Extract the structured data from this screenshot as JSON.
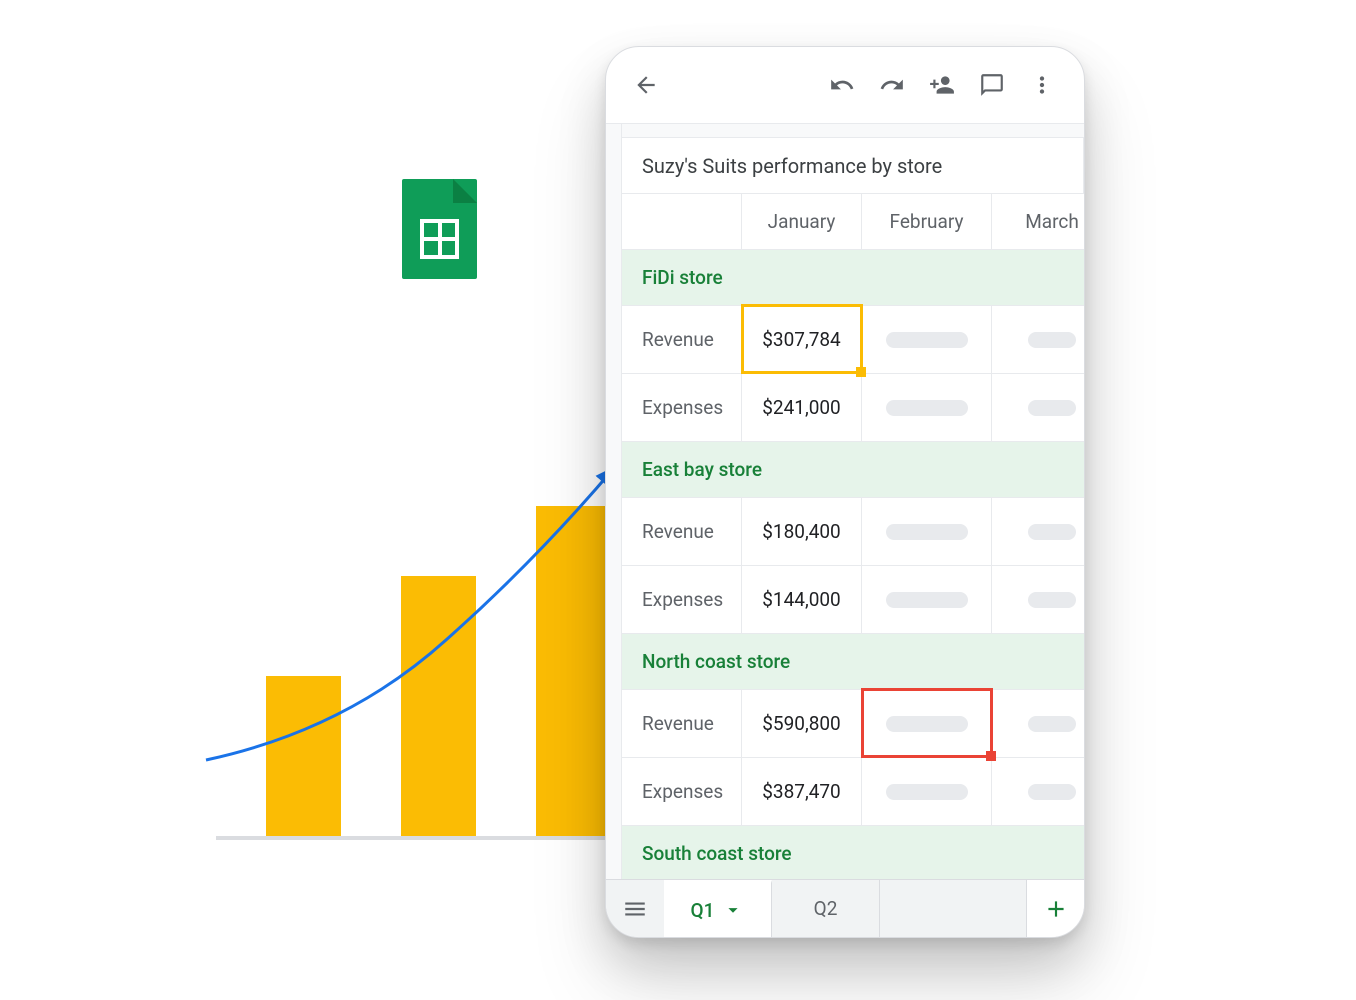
{
  "spreadsheet": {
    "title": "Suzy's Suits performance by store",
    "months": {
      "m1": "January",
      "m2": "February",
      "m3": "March"
    },
    "sections": [
      {
        "name": "FiDi store",
        "rows": {
          "revenue_label": "Revenue",
          "revenue_val": "$307,784",
          "expenses_label": "Expenses",
          "expenses_val": "$241,000"
        }
      },
      {
        "name": "East bay store",
        "rows": {
          "revenue_label": "Revenue",
          "revenue_val": "$180,400",
          "expenses_label": "Expenses",
          "expenses_val": "$144,000"
        }
      },
      {
        "name": "North coast store",
        "rows": {
          "revenue_label": "Revenue",
          "revenue_val": "$590,800",
          "expenses_label": "Expenses",
          "expenses_val": "$387,470"
        }
      },
      {
        "name": "South coast store"
      }
    ],
    "tabs": {
      "active": "Q1",
      "other": "Q2"
    }
  },
  "chart_data": {
    "type": "bar",
    "categories": [
      "1",
      "2",
      "3"
    ],
    "values": [
      160,
      260,
      330
    ],
    "title": "",
    "xlabel": "",
    "ylabel": "",
    "ylim": [
      0,
      350
    ],
    "note": "Decorative bar chart with rising trend arrow; values estimated from pixel heights (no axis labels present)."
  },
  "colors": {
    "accent_green": "#188038",
    "bar_yellow": "#fbbc04",
    "arrow_blue": "#1a73e8",
    "selection_yellow": "#fbbc04",
    "selection_red": "#ea4335"
  }
}
